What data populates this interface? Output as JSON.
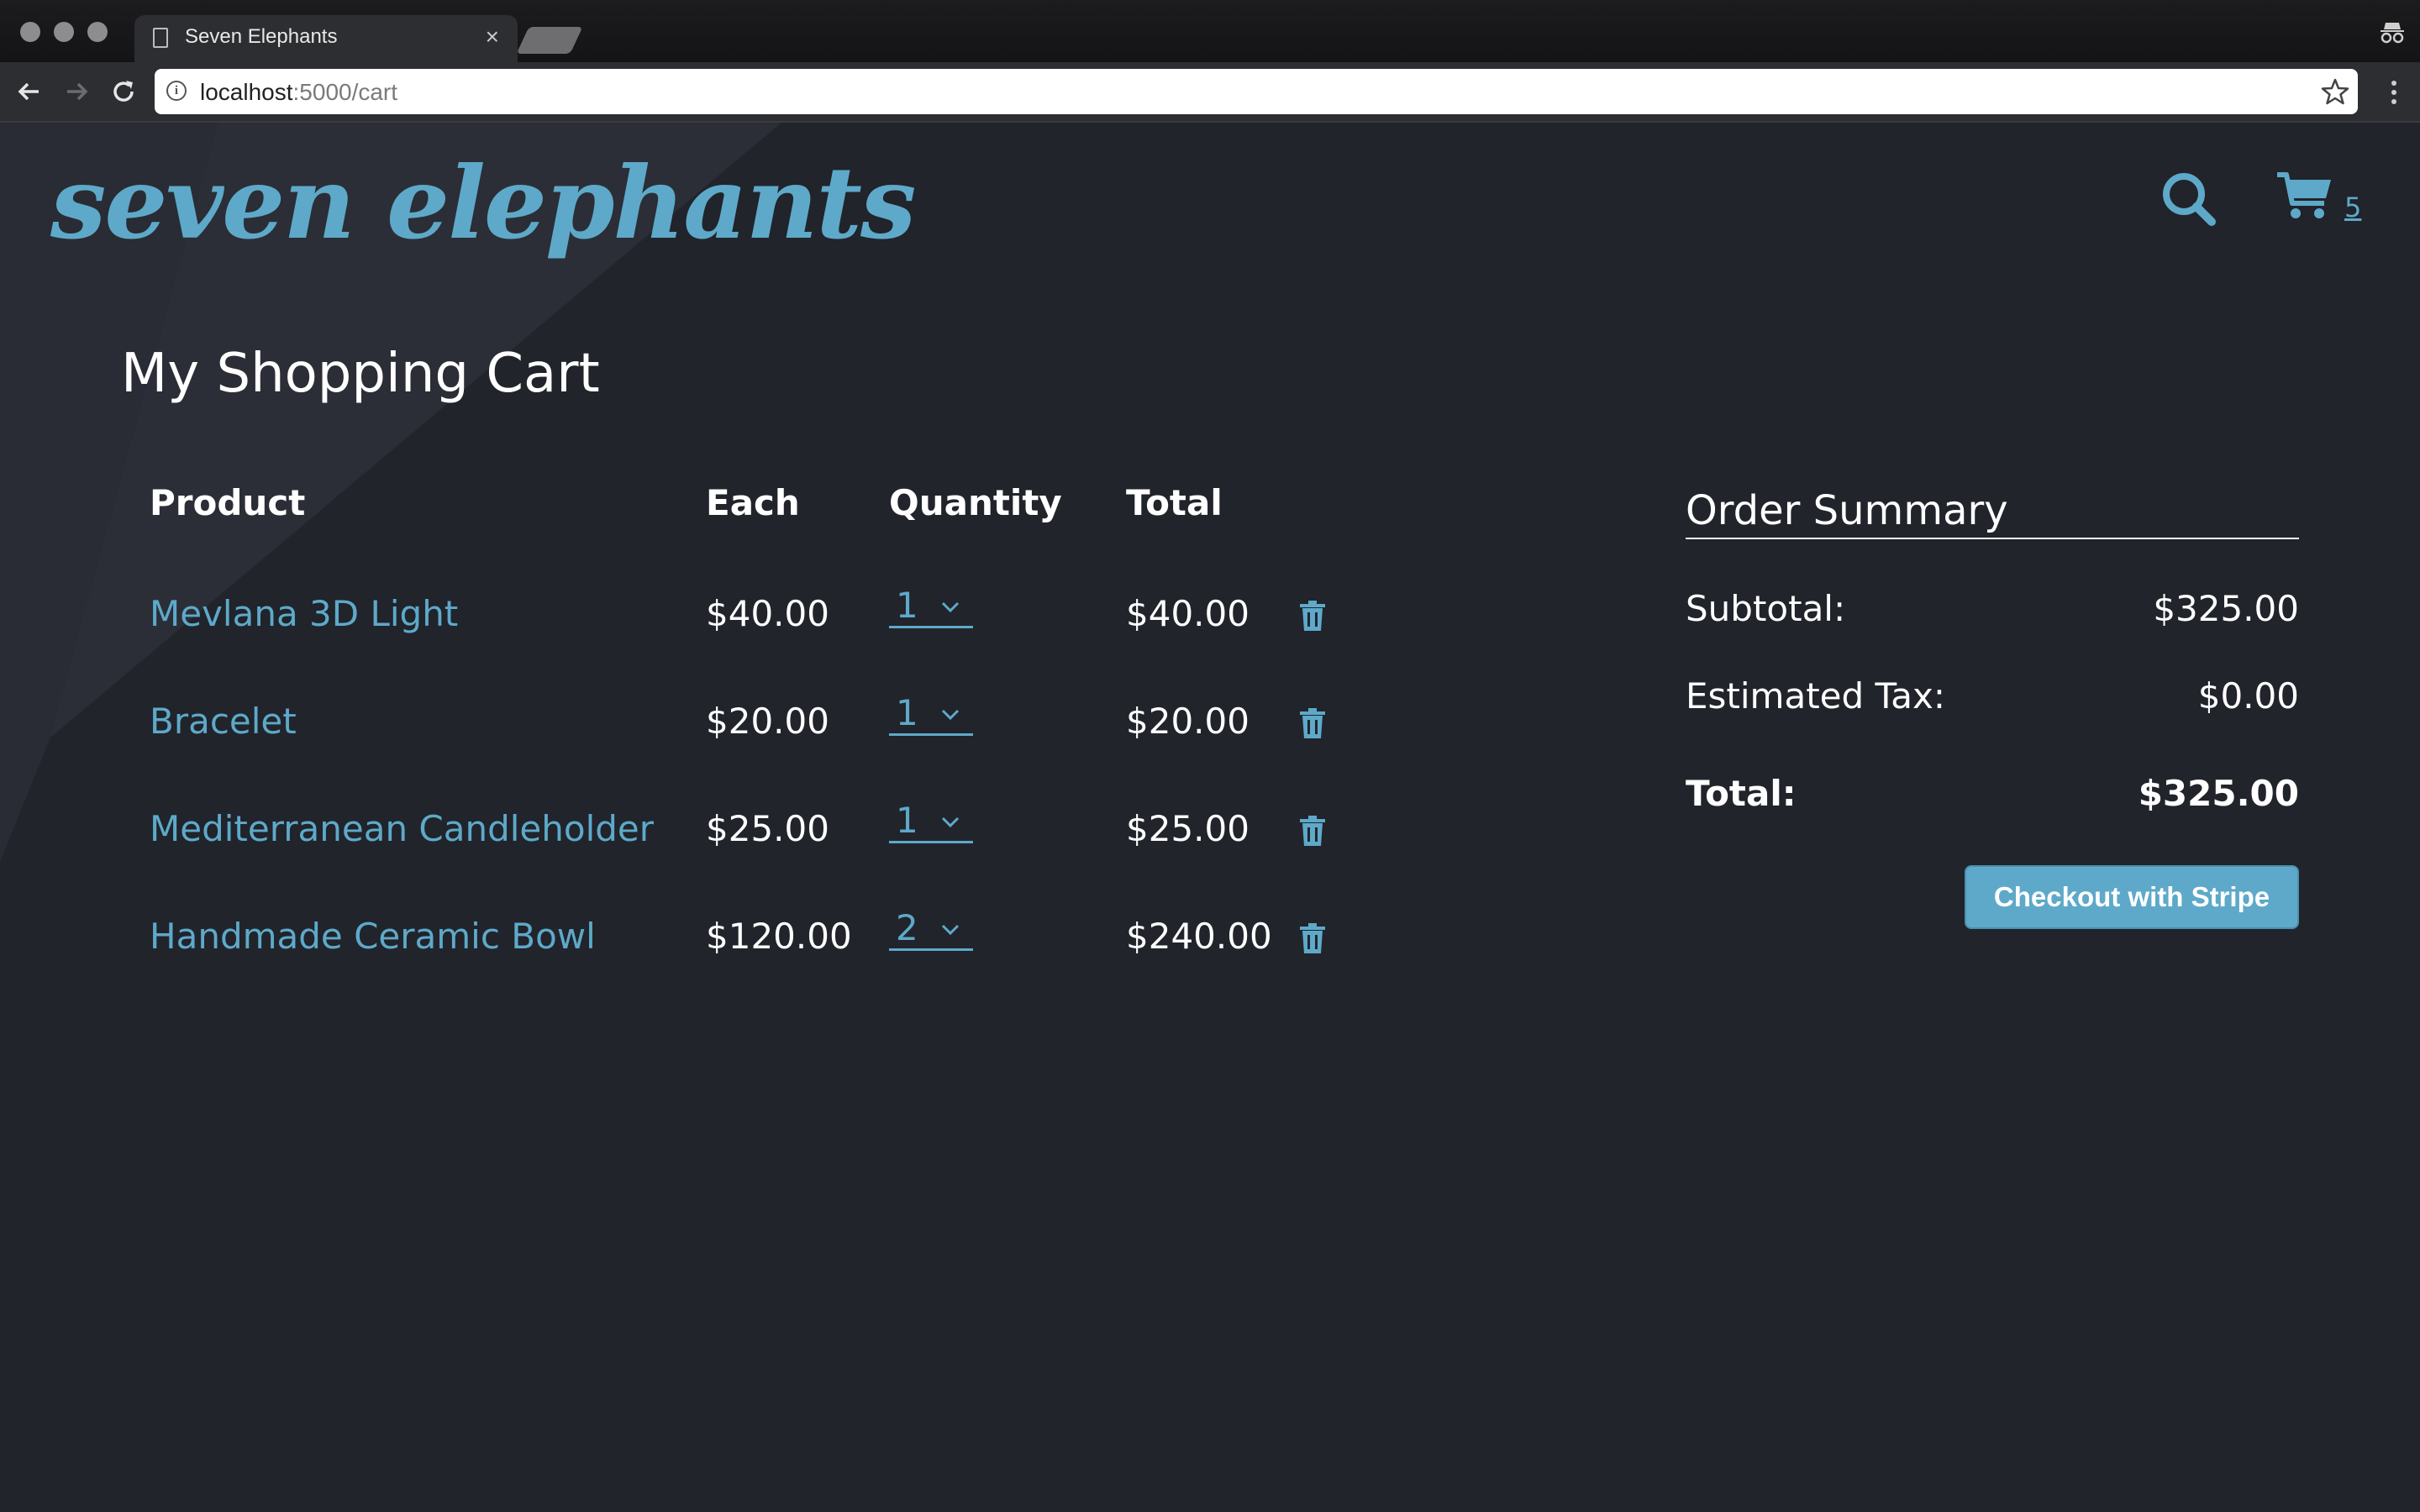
{
  "browser": {
    "tab_title": "Seven Elephants",
    "tab_close": "×",
    "url_host": "localhost",
    "url_path": ":5000/cart",
    "info_glyph": "i"
  },
  "header": {
    "logo": "seven elephants",
    "cart_count": "5"
  },
  "page_title": "My Shopping Cart",
  "cart_table": {
    "columns": [
      "Product",
      "Each",
      "Quantity",
      "Total"
    ],
    "rows": [
      {
        "product": "Mevlana 3D Light",
        "each": "$40.00",
        "quantity": "1",
        "total": "$40.00"
      },
      {
        "product": "Bracelet",
        "each": "$20.00",
        "quantity": "1",
        "total": "$20.00"
      },
      {
        "product": "Mediterranean Candleholder",
        "each": "$25.00",
        "quantity": "1",
        "total": "$25.00"
      },
      {
        "product": "Handmade Ceramic Bowl",
        "each": "$120.00",
        "quantity": "2",
        "total": "$240.00"
      }
    ]
  },
  "order_summary": {
    "title": "Order Summary",
    "subtotal_label": "Subtotal:",
    "subtotal_value": "$325.00",
    "tax_label": "Estimated Tax:",
    "tax_value": "$0.00",
    "total_label": "Total:",
    "total_value": "$325.00",
    "checkout_label": "Checkout with Stripe"
  },
  "colors": {
    "background": "#21242b",
    "accent": "#5ea9c9",
    "text": "#ffffff"
  },
  "icons": [
    "file-icon",
    "close-icon",
    "back-arrow-icon",
    "forward-arrow-icon",
    "reload-icon",
    "info-icon",
    "star-icon",
    "menu-icon",
    "incognito-icon",
    "search-icon",
    "cart-icon",
    "chevron-down-icon",
    "trash-icon"
  ]
}
